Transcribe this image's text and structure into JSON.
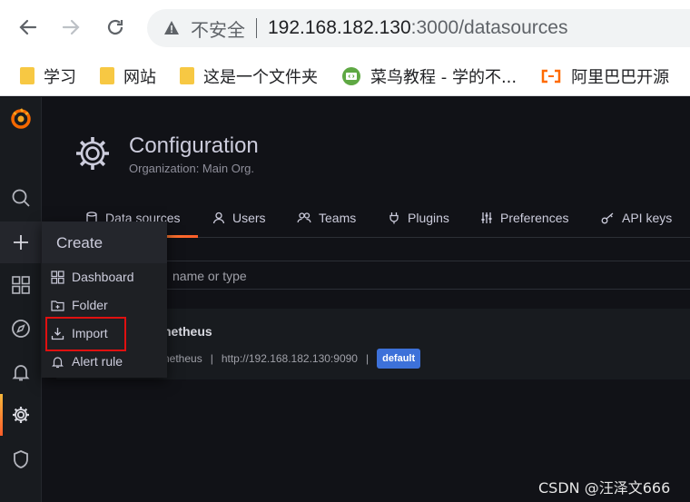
{
  "browser": {
    "insecure_label": "不安全",
    "url_host": "192.168.182.130",
    "url_path": ":3000/datasources",
    "bookmarks": [
      {
        "label": "学习",
        "icon": "folder-icon"
      },
      {
        "label": "网站",
        "icon": "folder-icon"
      },
      {
        "label": "这是一个文件夹",
        "icon": "folder-icon"
      },
      {
        "label": "菜鸟教程 - 学的不...",
        "icon": "runoob-icon"
      },
      {
        "label": "阿里巴巴开源",
        "icon": "alibaba-icon"
      }
    ]
  },
  "page": {
    "title": "Configuration",
    "subtitle": "Organization: Main Org."
  },
  "tabs": [
    {
      "label": "Data sources",
      "icon": "database-icon",
      "active": true
    },
    {
      "label": "Users",
      "icon": "user-icon"
    },
    {
      "label": "Teams",
      "icon": "users-icon"
    },
    {
      "label": "Plugins",
      "icon": "plug-icon"
    },
    {
      "label": "Preferences",
      "icon": "sliders-icon"
    },
    {
      "label": "API keys",
      "icon": "key-icon"
    }
  ],
  "search": {
    "placeholder": "name or type"
  },
  "datasource": {
    "name": "netheus",
    "type": "netheus",
    "url": "http://192.168.182.130:9090",
    "badge": "default",
    "sep": "|"
  },
  "create_menu": {
    "title": "Create",
    "items": [
      {
        "label": "Dashboard",
        "icon": "dashboard-icon"
      },
      {
        "label": "Folder",
        "icon": "folder-plus-icon"
      },
      {
        "label": "Import",
        "icon": "import-icon"
      },
      {
        "label": "Alert rule",
        "icon": "bell-icon"
      }
    ]
  },
  "watermark": "CSDN @汪泽文666",
  "colors": {
    "accent": "#f5b73b",
    "badge": "#3d71d9",
    "highlight": "#e01010"
  }
}
